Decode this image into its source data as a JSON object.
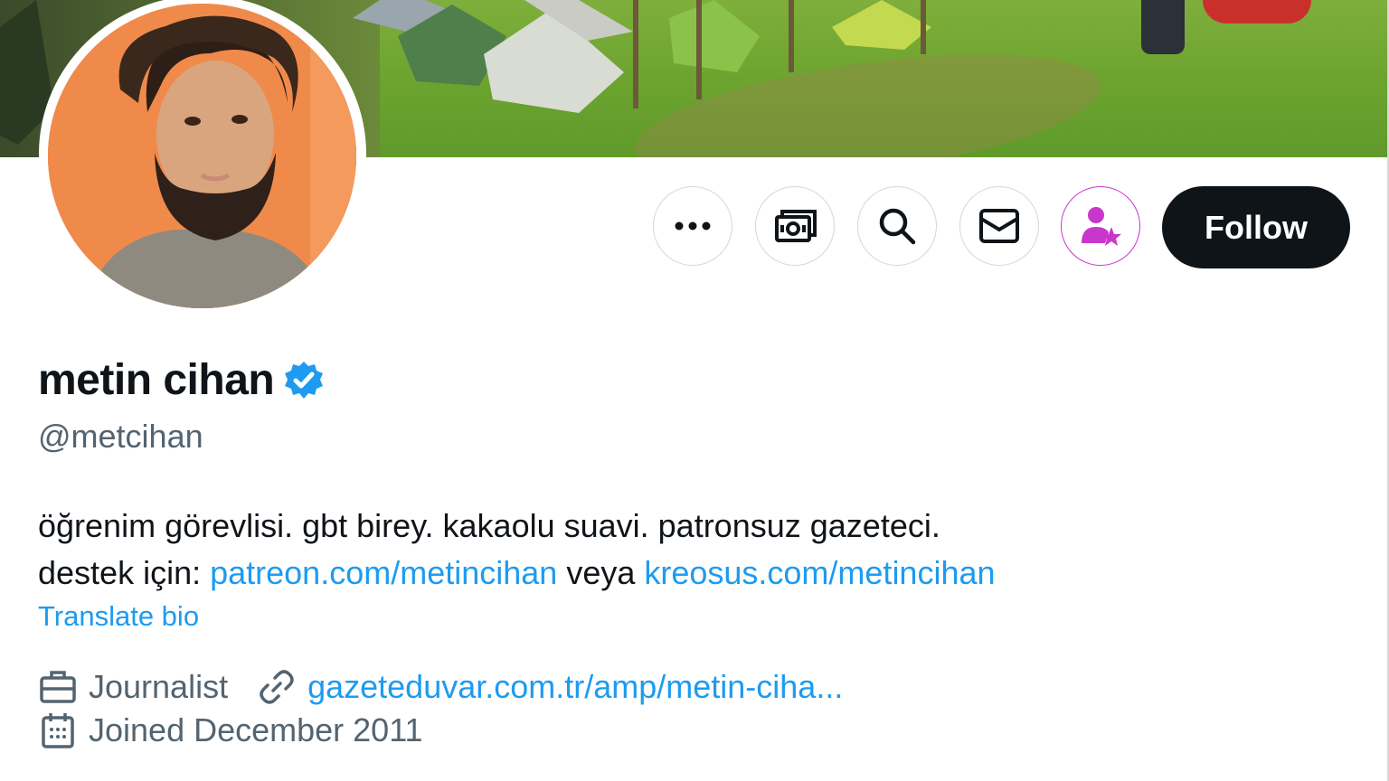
{
  "profile": {
    "name": "metin cihan",
    "handle": "@metcihan",
    "bio_line1": "öğrenim görevlisi. gbt birey. kakaolu suavi. patronsuz gazeteci.",
    "bio_line2_prefix": "destek için: ",
    "bio_link1": "patreon.com/metincihan",
    "bio_mid": " veya ",
    "bio_link2": "kreosus.com/metincihan",
    "translate_label": "Translate bio",
    "profession": "Journalist",
    "website": "gazeteduvar.com.tr/amp/metin-ciha...",
    "joined": "Joined December 2011"
  },
  "actions": {
    "more_icon": "more-icon",
    "tip_icon": "tip-money-icon",
    "search_icon": "search-icon",
    "message_icon": "mail-icon",
    "subscribe_icon": "subscribe-person-star-icon",
    "follow_label": "Follow"
  },
  "colors": {
    "accent_link": "#1d9bf0",
    "follow_bg": "#0f1419",
    "subscribe_accent": "#c936cc",
    "verified": "#1d9bf0",
    "muted_text": "#536471"
  }
}
